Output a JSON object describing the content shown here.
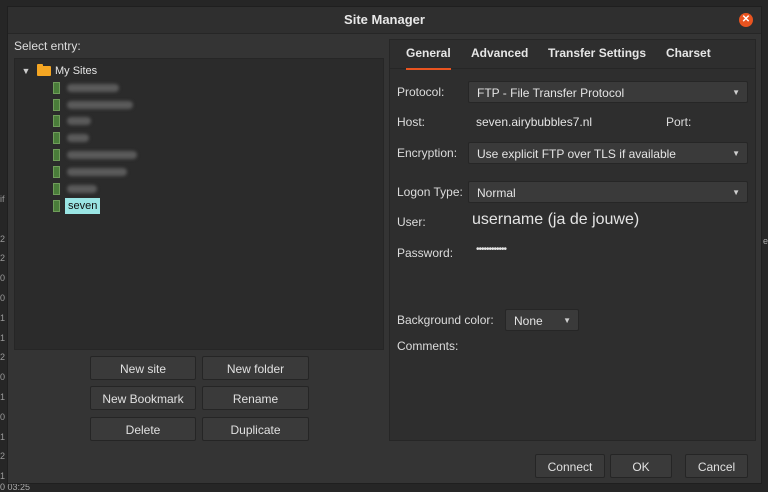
{
  "window": {
    "title": "Site Manager",
    "close_glyph": "✕"
  },
  "left": {
    "select_entry_label": "Select entry:",
    "tree": {
      "root_label": "My Sites",
      "selected_site": "seven"
    },
    "buttons": {
      "new_site": "New site",
      "new_folder": "New folder",
      "new_bookmark": "New Bookmark",
      "rename": "Rename",
      "delete": "Delete",
      "duplicate": "Duplicate"
    }
  },
  "tabs": {
    "general": "General",
    "advanced": "Advanced",
    "transfer_settings": "Transfer Settings",
    "charset": "Charset"
  },
  "general": {
    "protocol_label": "Protocol:",
    "protocol_value": "FTP - File Transfer Protocol",
    "host_label": "Host:",
    "host_value": "seven.airybubbles7.nl",
    "port_label": "Port:",
    "encryption_label": "Encryption:",
    "encryption_value": "Use explicit FTP over TLS if available",
    "logon_type_label": "Logon Type:",
    "logon_type_value": "Normal",
    "user_label": "User:",
    "user_value": "username (ja de jouwe)",
    "password_label": "Password:",
    "password_value": "••••••••••••",
    "background_color_label": "Background color:",
    "background_color_value": "None",
    "comments_label": "Comments:"
  },
  "footer": {
    "connect": "Connect",
    "ok": "OK",
    "cancel": "Cancel"
  },
  "background": {
    "left_numbers": [
      "if",
      "",
      "2",
      "2",
      "0",
      "0",
      "1",
      "1",
      "2",
      "0",
      "1",
      "0",
      "1",
      "2",
      "1"
    ],
    "status_text": "0 03:25",
    "right_text": "e"
  },
  "colors": {
    "accent": "#e95420",
    "selection": "#9ae5e4",
    "folder": "#f5a623"
  }
}
